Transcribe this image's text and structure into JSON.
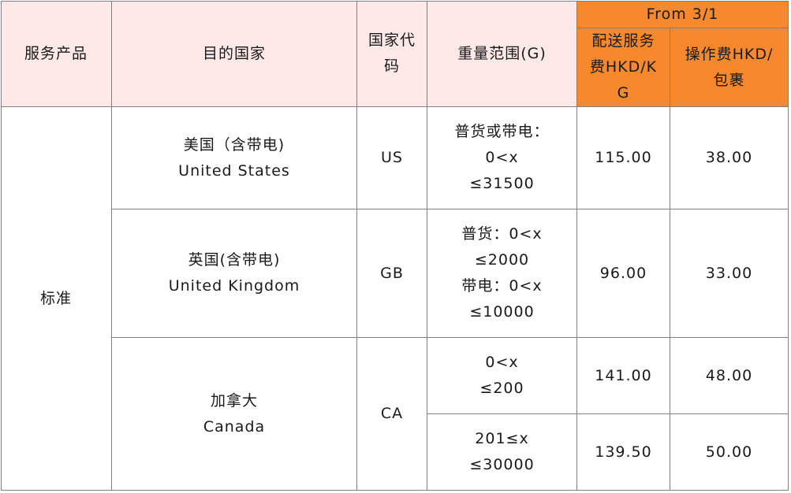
{
  "header": {
    "service_product": "服务产品",
    "destination": "目的国家",
    "country_code_line1": "国家代",
    "country_code_line2": "码",
    "weight_range": "重量范围(G)",
    "from_date": "From 3/1",
    "delivery_fee_line1": "配送服务",
    "delivery_fee_line2": "费HKD/K",
    "delivery_fee_line3": "G",
    "handling_fee_line1": "操作费HKD/",
    "handling_fee_line2": "包裹"
  },
  "service": "标准",
  "rows": [
    {
      "country_cn": "美国（含带电)",
      "country_en": "United States",
      "code": "US",
      "weight_lines": [
        "普货或带电：",
        "0<x",
        "≤31500"
      ],
      "delivery_fee": "115.00",
      "handling_fee": "38.00"
    },
    {
      "country_cn": "英国(含带电)",
      "country_en": "United Kingdom",
      "code": "GB",
      "weight_lines": [
        "普货：0<x",
        "≤2000",
        "带电：0<x",
        "≤10000"
      ],
      "delivery_fee": "96.00",
      "handling_fee": "33.00"
    },
    {
      "country_cn": "加拿大",
      "country_en": "Canada",
      "code": "CA",
      "tiers": [
        {
          "weight_lines": [
            "0<x",
            "≤200"
          ],
          "delivery_fee": "141.00",
          "handling_fee": "48.00"
        },
        {
          "weight_lines": [
            "201≤x",
            "≤30000"
          ],
          "delivery_fee": "139.50",
          "handling_fee": "50.00"
        }
      ]
    }
  ],
  "colors": {
    "header_pink": "#ffe8e8",
    "header_orange": "#f6892e",
    "border": "#7f7f7f"
  }
}
